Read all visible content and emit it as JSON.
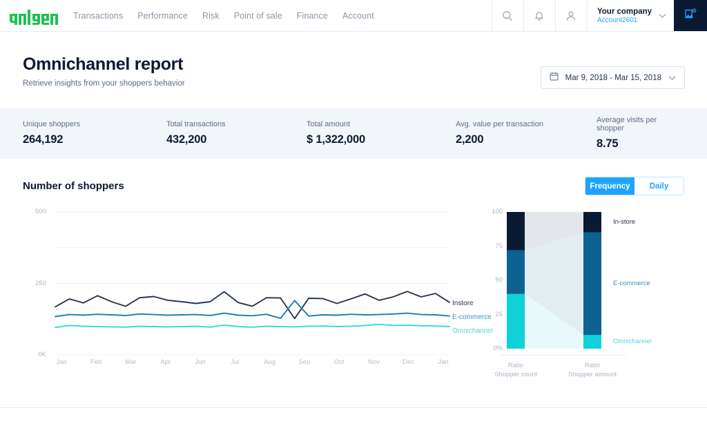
{
  "topnav": {
    "logo_text": "adyen",
    "logo_color": "#21bf53",
    "links": [
      {
        "label": "Transactions"
      },
      {
        "label": "Performance"
      },
      {
        "label": "Risk"
      },
      {
        "label": "Point of sale"
      },
      {
        "label": "Finance"
      },
      {
        "label": "Account"
      }
    ],
    "icons": [
      {
        "name": "search-icon"
      },
      {
        "name": "bell-icon"
      },
      {
        "name": "user-icon"
      }
    ],
    "company": {
      "name": "Your company",
      "account": "Account2601",
      "chevron": "chevron-down-icon"
    },
    "app_tile": {
      "name": "image-upload-icon",
      "bg": "#0b1a33",
      "fg": "#1fa3ff"
    }
  },
  "page": {
    "title": "Omnichannel report",
    "subtitle": "Retrieve insights from your shoppers behavior",
    "date_range": "Mar 9, 2018 - Mar 15, 2018"
  },
  "kpis": [
    {
      "label": "Unique shoppers",
      "value": "264,192"
    },
    {
      "label": "Total transactions",
      "value": "432,200"
    },
    {
      "label": "Total amount",
      "value": "$ 1,322,000"
    },
    {
      "label": "Avg. value per transaction",
      "value": "2,200"
    },
    {
      "label": "Average visits per shopper",
      "value": "8.75"
    }
  ],
  "chart_section": {
    "title": "Number of shoppers",
    "toggle": {
      "active": "Frequency",
      "inactive": "Daily"
    }
  },
  "chart_data": [
    {
      "type": "line",
      "title": "Number of shoppers",
      "xlabel": "",
      "ylabel": "",
      "ylim": [
        0,
        500
      ],
      "yticks": [
        0,
        250,
        500
      ],
      "ytick_labels": [
        "0K",
        "250",
        "500"
      ],
      "gridlines": [
        0,
        250,
        375,
        500
      ],
      "grid": true,
      "legend_position": "right",
      "categories": [
        "Jan",
        "Feb",
        "Mar",
        "Apr",
        "Jun",
        "Jul",
        "Aug",
        "Sep",
        "Oct",
        "Nov",
        "Dec",
        "Jan"
      ],
      "x_points": 24,
      "series": [
        {
          "name": "Instore",
          "color": "#26344d",
          "values": [
            168,
            196,
            182,
            207,
            186,
            170,
            200,
            204,
            191,
            186,
            180,
            186,
            221,
            183,
            170,
            200,
            199,
            127,
            198,
            197,
            180,
            196,
            213,
            191,
            203,
            222,
            203,
            215,
            184
          ]
        },
        {
          "name": "E-commerce",
          "color": "#1a7ea8",
          "values": [
            134,
            141,
            139,
            142,
            140,
            138,
            143,
            141,
            139,
            140,
            141,
            138,
            146,
            139,
            137,
            142,
            128,
            190,
            136,
            140,
            139,
            142,
            140,
            141,
            143,
            146,
            141,
            140,
            136
          ]
        },
        {
          "name": "Omnichannel",
          "color": "#2ed9e0",
          "values": [
            96,
            103,
            100,
            99,
            98,
            97,
            100,
            99,
            98,
            99,
            100,
            97,
            104,
            99,
            97,
            100,
            99,
            98,
            100,
            101,
            99,
            100,
            103,
            107,
            103,
            104,
            102,
            101,
            99
          ]
        }
      ]
    },
    {
      "type": "bar",
      "subtype": "stacked-alluvial",
      "title": "",
      "ylim": [
        0,
        100
      ],
      "yticks": [
        0,
        25,
        50,
        75,
        100
      ],
      "ytick_labels": [
        "0%",
        "25",
        "50",
        "75",
        "100"
      ],
      "categories": [
        "Ratio Shopper count",
        "Ratio Shopper amount"
      ],
      "category_lines": [
        [
          "Ratio",
          "Shopper count"
        ],
        [
          "Ratio",
          "Shopper amount"
        ]
      ],
      "series": [
        {
          "name": "In-store",
          "color": "#0b1a33",
          "values": [
            28,
            15
          ]
        },
        {
          "name": "E-commerce",
          "color": "#0c6291",
          "values": [
            32,
            75
          ]
        },
        {
          "name": "Omnichannel",
          "color": "#0fd2d8",
          "values": [
            40,
            10
          ]
        }
      ]
    }
  ]
}
